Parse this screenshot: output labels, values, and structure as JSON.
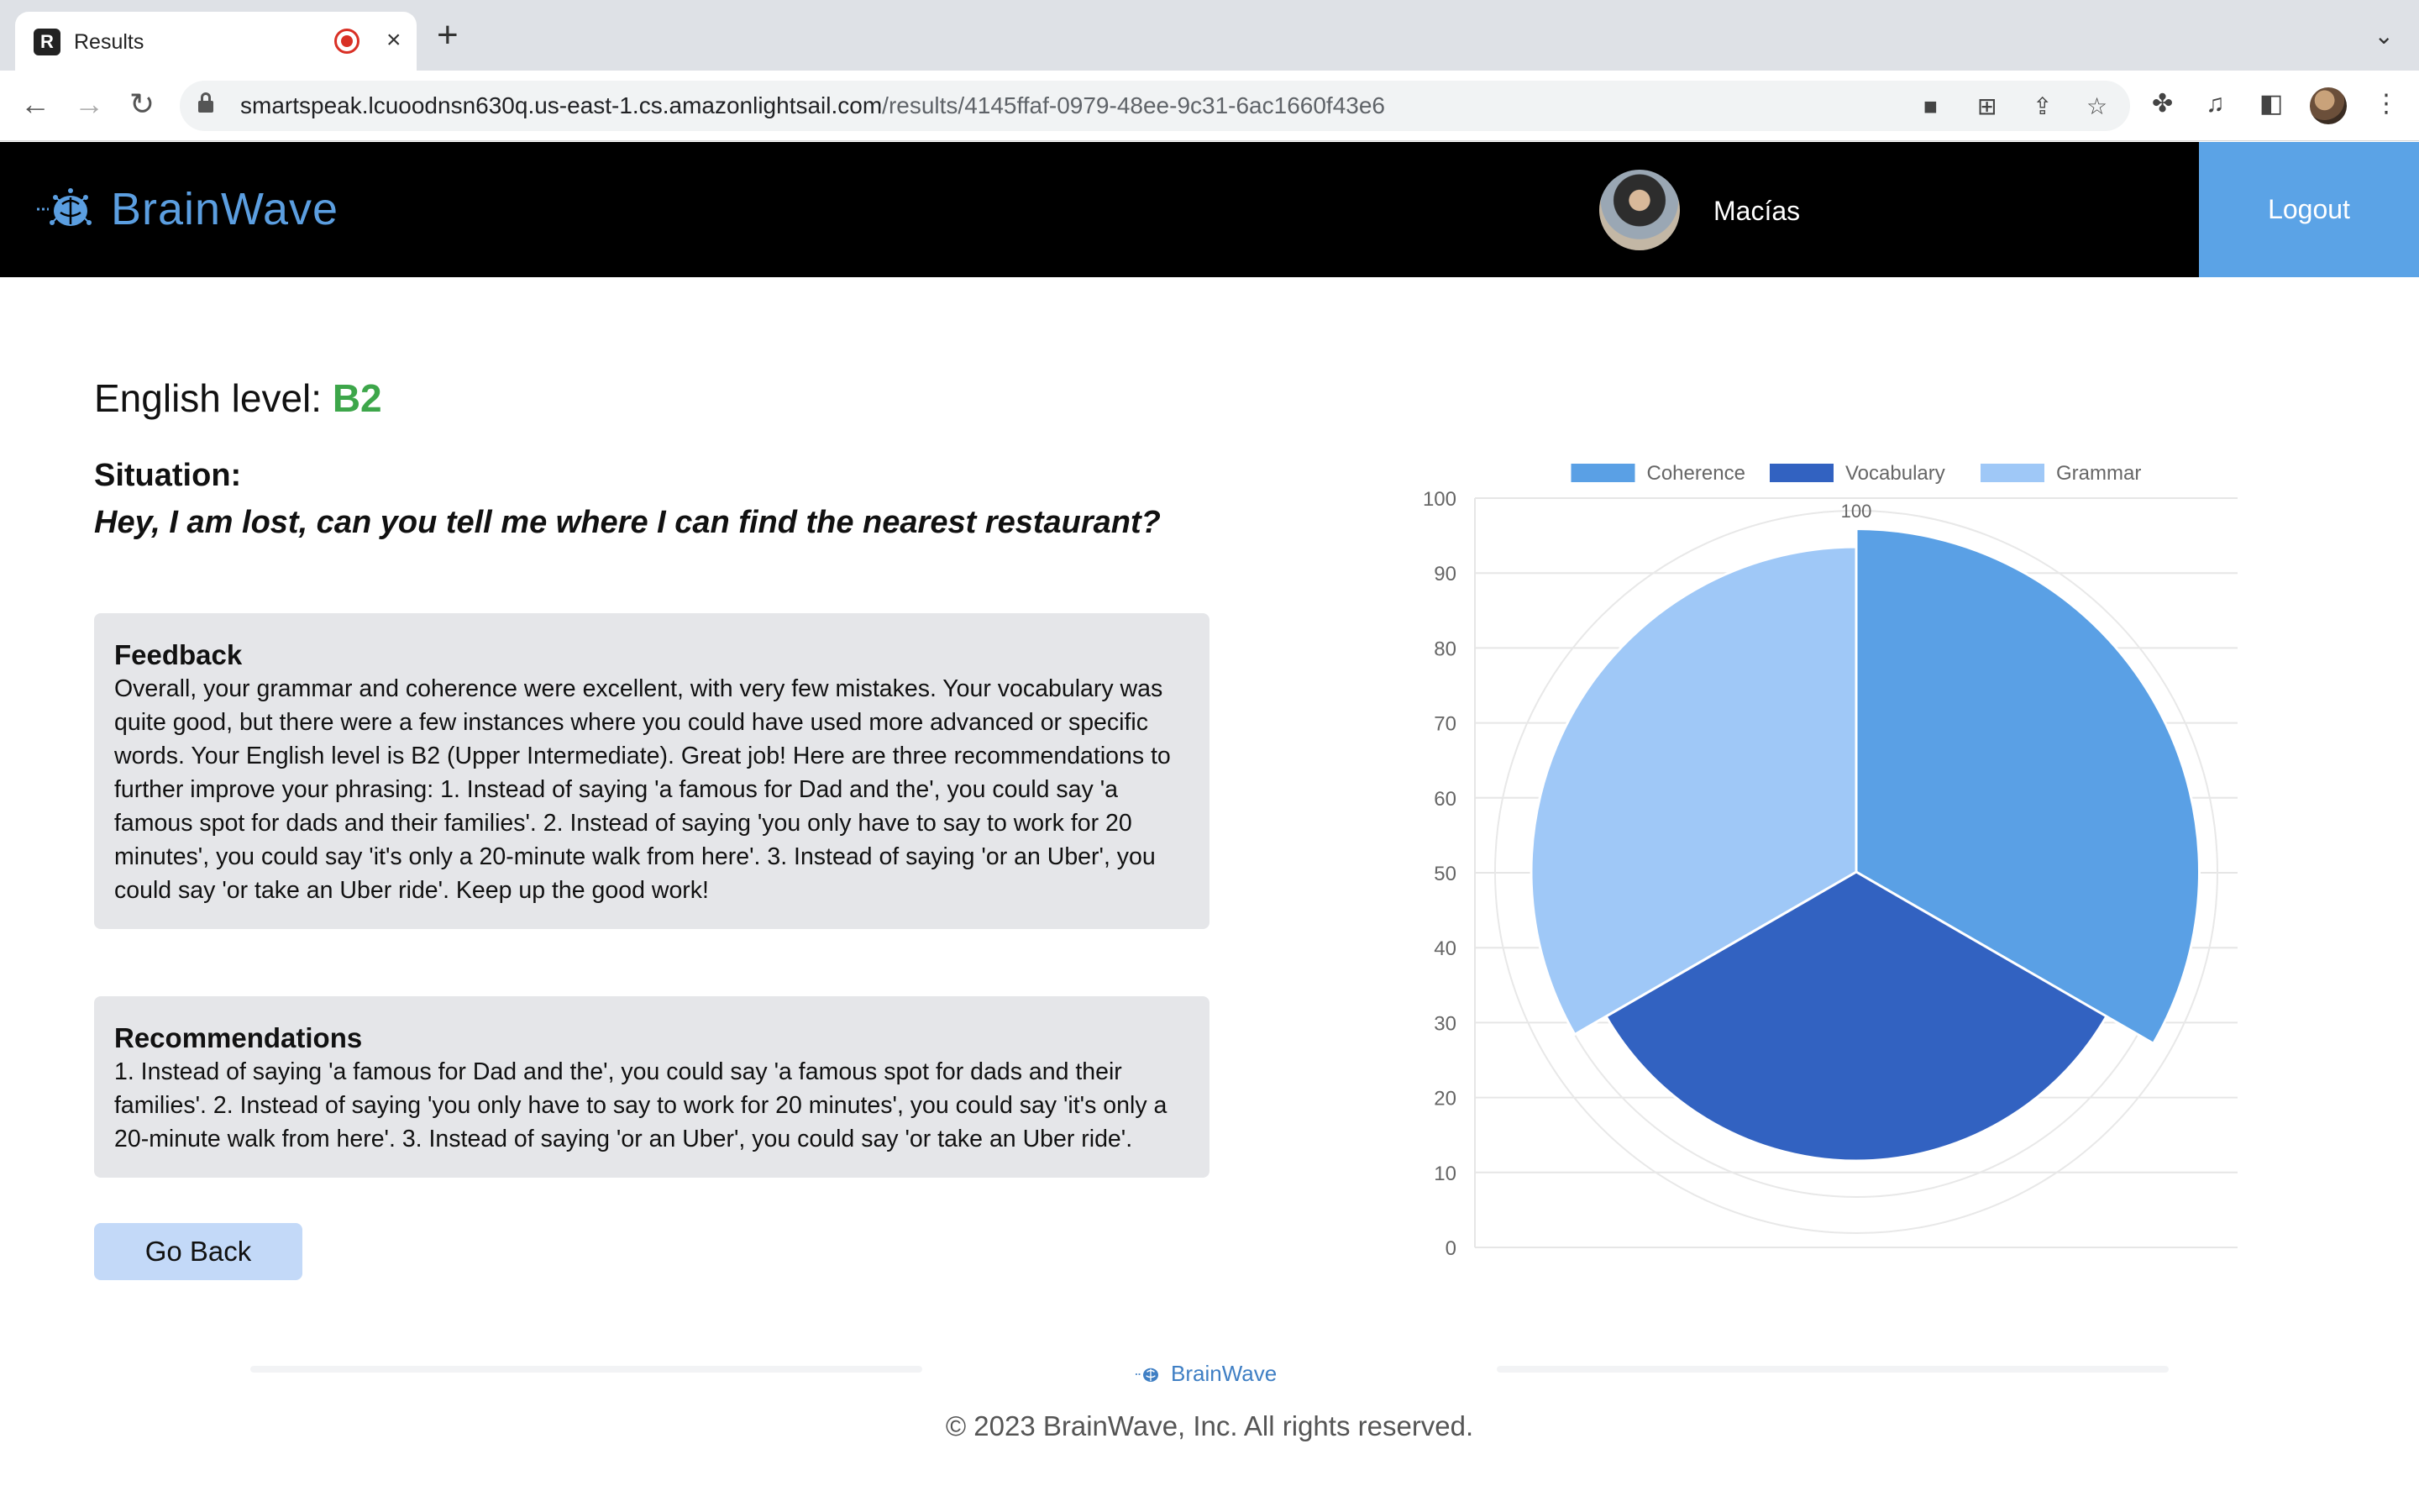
{
  "browser": {
    "tab_title": "Results",
    "tab_close": "×",
    "new_tab": "+",
    "tab_menu": "⌄",
    "url_host": "smartspeak.lcuoodnsn630q.us-east-1.cs.amazonlightsail.com",
    "url_path": "/results/4145ffaf-0979-48ee-9c31-6ac1660f43e6",
    "icons": [
      "back-icon",
      "forward-icon",
      "reload-icon",
      "lock-icon",
      "camera-icon",
      "translate-icon",
      "share-icon",
      "bookmark-star-icon",
      "extensions-icon",
      "media-icon",
      "side-panel-icon",
      "profile-icon",
      "more-icon"
    ]
  },
  "header": {
    "brand": "BrainWave",
    "user_name": "Macías",
    "logout_label": "Logout"
  },
  "main": {
    "level_label": "English level: ",
    "level_value": "B2",
    "situation_label": "Situation:",
    "situation_text": "Hey, I am lost, can you tell me where I can find the nearest restaurant?",
    "feedback_title": "Feedback",
    "feedback_text": "Overall, your grammar and coherence were excellent, with very few mistakes. Your vocabulary was quite good, but there were a few instances where you could have used more advanced or specific words. Your English level is B2 (Upper Intermediate). Great job! Here are three recommendations to further improve your phrasing: 1. Instead of saying 'a famous for Dad and the', you could say 'a famous spot for dads and their families'. 2. Instead of saying 'you only have to say to work for 20 minutes', you could say 'it's only a 20-minute walk from here'. 3. Instead of saying 'or an Uber', you could say 'or take an Uber ride'. Keep up the good work!",
    "reco_title": "Recommendations",
    "reco_text": "1. Instead of saying 'a famous for Dad and the', you could say 'a famous spot for dads and their families'. 2. Instead of saying 'you only have to say to work for 20 minutes', you could say 'it's only a 20-minute walk from here'. 3. Instead of saying 'or an Uber', you could say 'or take an Uber ride'.",
    "back_label": "Go Back"
  },
  "chart_data": {
    "type": "polarArea",
    "categories": [
      "Coherence",
      "Vocabulary",
      "Grammar"
    ],
    "values": [
      95,
      80,
      90
    ],
    "colors": [
      "#5aa0e5",
      "#3262c1",
      "#9fc8f7"
    ],
    "legend_position": "top",
    "y_ticks": [
      "0",
      "10",
      "20",
      "30",
      "40",
      "50",
      "60",
      "70",
      "80",
      "90",
      "100"
    ],
    "ylim": [
      0,
      100
    ],
    "radial_tick_label": "100",
    "grid": true
  },
  "footer": {
    "brand": "BrainWave",
    "copyright": "© 2023 BrainWave, Inc. All rights reserved."
  }
}
